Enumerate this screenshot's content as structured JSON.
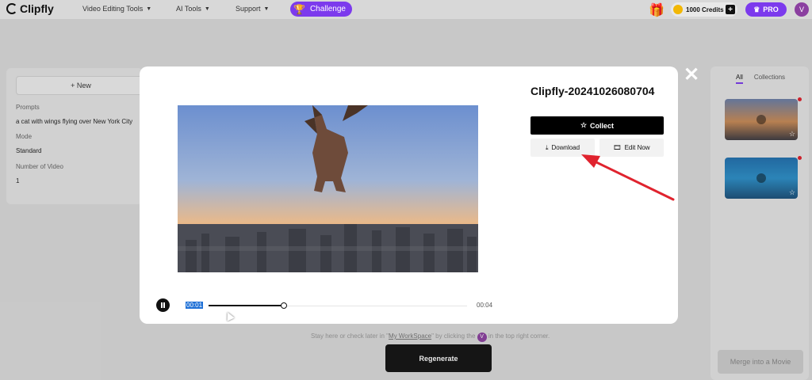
{
  "brand": {
    "name": "Clipfly"
  },
  "nav": {
    "items": [
      {
        "label": "Video Editing Tools"
      },
      {
        "label": "AI Tools"
      },
      {
        "label": "Support"
      }
    ],
    "challenge_label": "Challenge",
    "credits_label": "1000 Credits",
    "pro_label": "PRO",
    "avatar_initial": "V"
  },
  "left_panel": {
    "new_label": "+ New",
    "prompts_label": "Prompts",
    "prompts_value": "a cat with wings flying over New York City",
    "mode_label": "Mode",
    "mode_value": "Standard",
    "count_label": "Number of Video",
    "count_value": "1"
  },
  "right_panel": {
    "tabs": [
      {
        "label": "All"
      },
      {
        "label": "Collections"
      }
    ],
    "merge_label": "Merge into a Movie"
  },
  "background": {
    "hint_prefix": "Stay here or check later in",
    "hint_link": "My WorkSpace",
    "hint_middle": "by clicking the",
    "hint_suffix": "in the top right corner.",
    "regenerate_label": "Regenerate"
  },
  "modal": {
    "title": "Clipfly-20241026080704",
    "collect_label": "Collect",
    "download_label": "Download",
    "edit_label": "Edit Now",
    "player": {
      "current_time": "00:01",
      "total_time": "00:04",
      "progress": 0.29
    }
  },
  "colors": {
    "accent": "#7c3aed",
    "annotation_arrow": "#e0232e"
  }
}
